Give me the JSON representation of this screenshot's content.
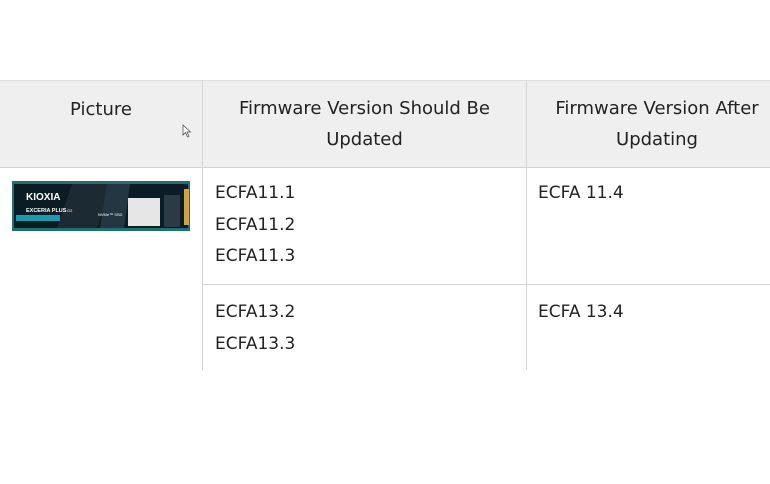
{
  "table": {
    "headers": {
      "picture": "Picture",
      "fw_to_update_line1": "Firmware Version Should Be",
      "fw_to_update_line2": "Updated",
      "fw_after_line1": "Firmware Version After",
      "fw_after_line2": "Updating"
    },
    "rows": [
      {
        "should_update": [
          "ECFA11.1",
          "ECFA11.2",
          "ECFA11.3"
        ],
        "after": "ECFA 11.4"
      },
      {
        "should_update": [
          "ECFA13.2",
          "ECFA13.3"
        ],
        "after": "ECFA 13.4"
      }
    ],
    "product_image": {
      "brand": "KIOXIA",
      "model": "EXCERIA PLUS",
      "model_suffix": "G2",
      "type": "NVMe™ SSD"
    }
  },
  "icons": {
    "cursor": "mouse-pointer-icon"
  }
}
